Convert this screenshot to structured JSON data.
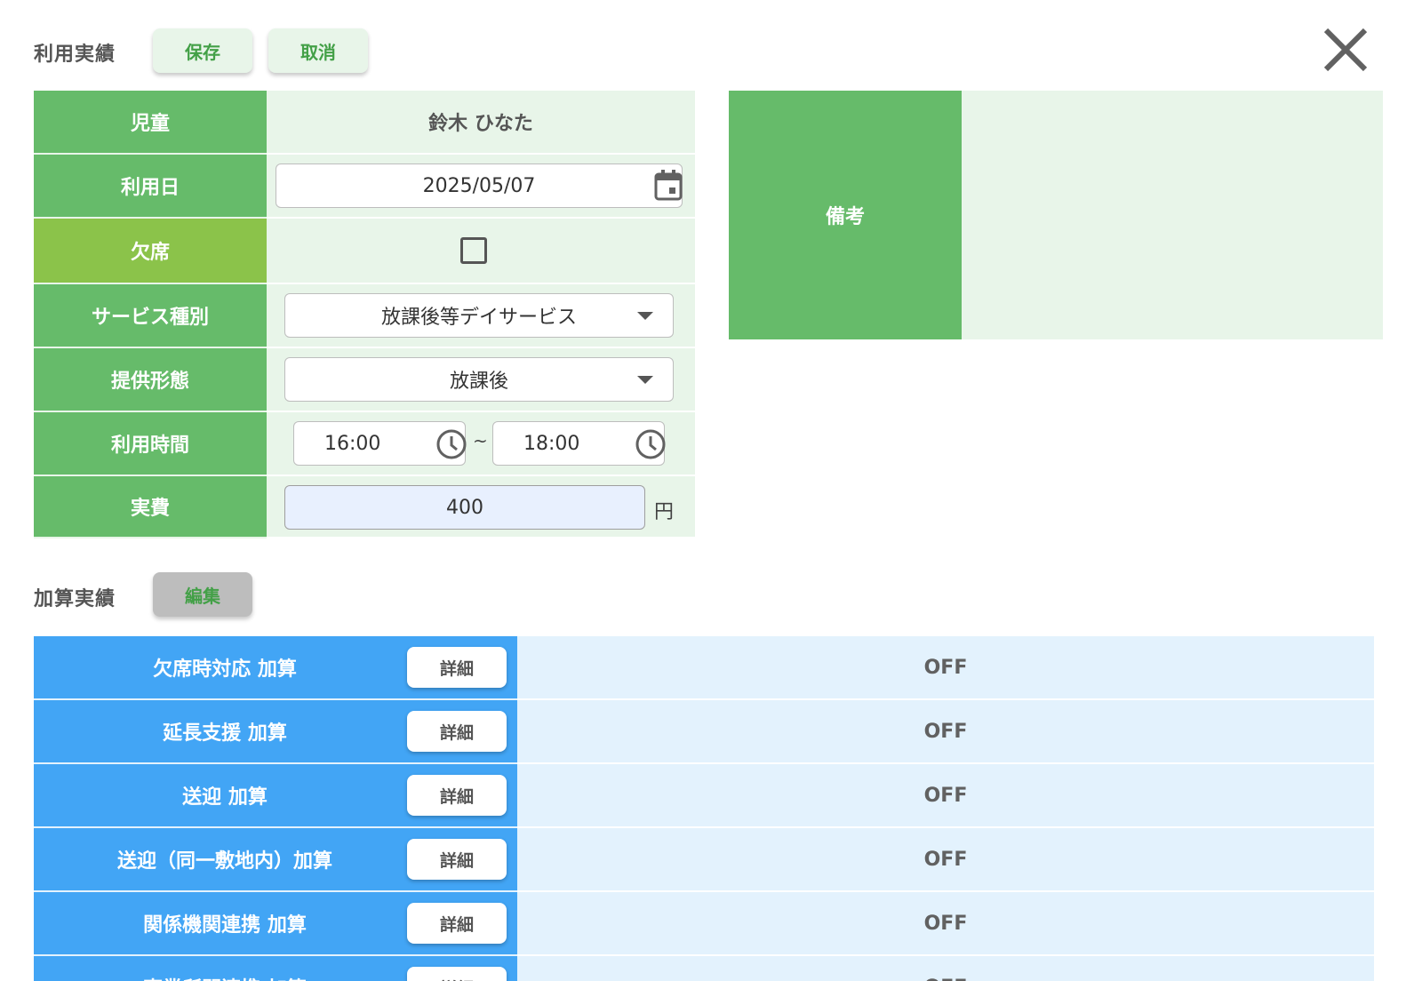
{
  "usage": {
    "section_title": "利用実績",
    "save_label": "保存",
    "cancel_label": "取消",
    "labels": {
      "child": "児童",
      "date": "利用日",
      "absent": "欠席",
      "service_type": "サービス種別",
      "provision": "提供形態",
      "time": "利用時間",
      "cost": "実費"
    },
    "child_name": "鈴木 ひなた",
    "date_value": "2025/05/07",
    "absent_checked": false,
    "service_type_value": "放課後等デイサービス",
    "provision_value": "放課後",
    "time_start": "16:00",
    "time_separator": "~",
    "time_end": "18:00",
    "cost_value": "400",
    "cost_unit": "円"
  },
  "remarks": {
    "label": "備考",
    "value": ""
  },
  "additions": {
    "section_title": "加算実績",
    "edit_label": "編集",
    "detail_label": "詳細",
    "items": [
      {
        "name": "欠席時対応 加算",
        "status": "OFF"
      },
      {
        "name": "延長支援 加算",
        "status": "OFF"
      },
      {
        "name": "送迎 加算",
        "status": "OFF"
      },
      {
        "name": "送迎（同一敷地内）加算",
        "status": "OFF"
      },
      {
        "name": "関係機関連携 加算",
        "status": "OFF"
      },
      {
        "name": "事業所間連携 加算",
        "status": "OFF"
      }
    ]
  },
  "icons": {
    "close": "close-icon",
    "calendar": "calendar-icon",
    "dropdown": "chevron-down-icon",
    "clock": "clock-icon"
  },
  "colors": {
    "label_green": "#66bb6a",
    "absent_green": "#8bc34a",
    "value_bg": "#e8f5e9",
    "addition_blue": "#42a5f5",
    "addition_bg": "#e3f2fd"
  }
}
